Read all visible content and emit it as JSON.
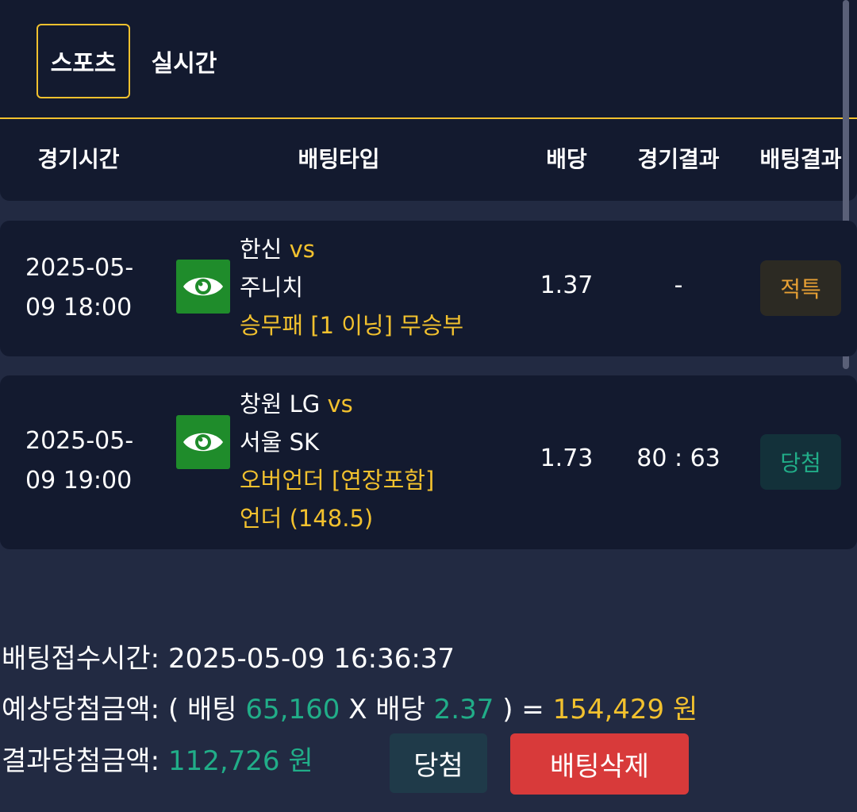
{
  "tabs": {
    "sports": "스포츠",
    "live": "실시간"
  },
  "columns": {
    "time": "경기시간",
    "bet_type": "배팅타입",
    "odds": "배당",
    "game_result": "경기결과",
    "bet_result": "배팅결과"
  },
  "rows": [
    {
      "time_line1": "2025-05-",
      "time_line2": "09 18:00",
      "icon": "eye-icon",
      "home": "한신",
      "vs": "vs",
      "away": "주니치",
      "market_line1": "승무패 [1 이닝] 무승부",
      "market_line2": "",
      "odds": "1.37",
      "score": "-",
      "status": "적특"
    },
    {
      "time_line1": "2025-05-",
      "time_line2": "09 19:00",
      "icon": "eye-icon",
      "home": "창원 LG",
      "vs": "vs",
      "away": "서울 SK",
      "market_line1": "오버언더 [연장포함]",
      "market_line2": "언더 (148.5)",
      "odds": "1.73",
      "score": "80 : 63",
      "status": "당첨"
    }
  ],
  "summary": {
    "received_label": "배팅접수시간:",
    "received_value": "2025-05-09 16:36:37",
    "expected_label": "예상당첨금액:",
    "open_paren": "(",
    "bet_label": "배팅",
    "bet_amount": "65,160",
    "times": "X",
    "odds_label": "배당",
    "total_odds": "2.37",
    "close_paren_eq": ") =",
    "expected_amount": "154,429 원",
    "result_label": "결과당첨금액:",
    "result_amount": "112,726 원"
  },
  "buttons": {
    "win": "당첨",
    "delete": "배팅삭제"
  },
  "colors": {
    "background": "#222a42",
    "panel": "#131a2f",
    "accent_gold": "#f2c12e",
    "win_green": "#21ad88",
    "eye_green": "#1f8c2b",
    "delete_red": "#d83a3a"
  }
}
